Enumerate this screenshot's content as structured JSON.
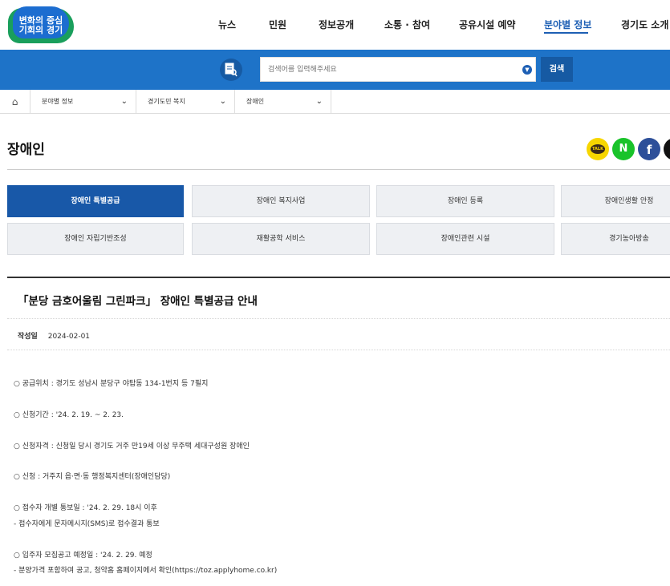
{
  "logo": {
    "line1": "변화의 중심",
    "line2": "기회의 경기"
  },
  "nav": [
    "뉴스",
    "민원",
    "정보공개",
    "소통 · 참여",
    "공유시설 예약",
    "분야별 정보",
    "경기도 소개"
  ],
  "search": {
    "placeholder": "검색어를 입력해주세요",
    "button": "검색"
  },
  "breadcrumb": [
    "분야별 정보",
    "경기도민 복지",
    "장애인"
  ],
  "page_title": "장애인",
  "share": {
    "kakao": "TALK",
    "naver": "N",
    "facebook": "f"
  },
  "tabs": [
    "장애인 특별공급",
    "장애인 복지사업",
    "장애인 등록",
    "장애인생활 안정",
    "장애인 자립기반조성",
    "재활공학 서비스",
    "장애인관련 시설",
    "경기농아방송"
  ],
  "article": {
    "title": "「분당 금호어울림 그린파크」 장애인 특별공급 안내",
    "meta_label": "작성일",
    "date": "2024-02-01",
    "lines": [
      "○ 공급위치 : 경기도 성남시 분당구 야탑동 134-1번지 등 7필지",
      "○ 신청기간 : '24. 2. 19. ~ 2. 23.",
      "○ 신청자격 : 신청일 당시 경기도 거주 만19세 이상 무주택 세대구성원 장애인",
      "○ 신청 : 거주지 읍·면·동 행정복지센터(장애인담당)",
      "○ 접수자 개별 통보일 : '24. 2. 29. 18시 이후",
      " - 접수자에게 문자메시지(SMS)로 접수결과 통보",
      "○ 입주자 모집공고 예정일 :  '24. 2. 29. 예정",
      " - 분양가격 포함하여 공고, 청약홈 홈페이지에서 확인(https://toz.applyhome.co.kr)"
    ]
  }
}
